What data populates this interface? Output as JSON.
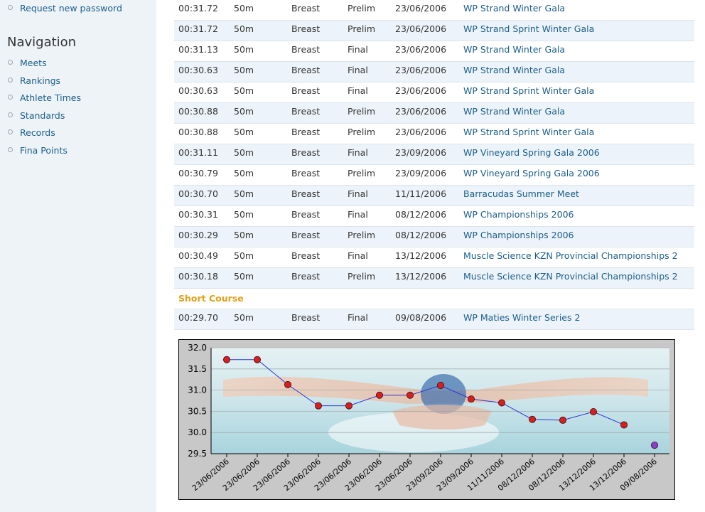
{
  "sidebar": {
    "top_link": "Request new password",
    "nav_title": "Navigation",
    "nav_items": [
      "Meets",
      "Rankings",
      "Athlete Times",
      "Standards",
      "Records",
      "Fina Points"
    ]
  },
  "results": {
    "long_course_rows": [
      {
        "time": "00:31.72",
        "distance": "50m",
        "stroke": "Breast",
        "round": "Prelim",
        "date": "23/06/2006",
        "meet": "WP Strand Winter Gala"
      },
      {
        "time": "00:31.72",
        "distance": "50m",
        "stroke": "Breast",
        "round": "Prelim",
        "date": "23/06/2006",
        "meet": "WP Strand Sprint Winter Gala"
      },
      {
        "time": "00:31.13",
        "distance": "50m",
        "stroke": "Breast",
        "round": "Final",
        "date": "23/06/2006",
        "meet": "WP Strand Winter Gala"
      },
      {
        "time": "00:30.63",
        "distance": "50m",
        "stroke": "Breast",
        "round": "Final",
        "date": "23/06/2006",
        "meet": "WP Strand Winter Gala"
      },
      {
        "time": "00:30.63",
        "distance": "50m",
        "stroke": "Breast",
        "round": "Final",
        "date": "23/06/2006",
        "meet": "WP Strand Sprint Winter Gala"
      },
      {
        "time": "00:30.88",
        "distance": "50m",
        "stroke": "Breast",
        "round": "Prelim",
        "date": "23/06/2006",
        "meet": "WP Strand Winter Gala"
      },
      {
        "time": "00:30.88",
        "distance": "50m",
        "stroke": "Breast",
        "round": "Prelim",
        "date": "23/06/2006",
        "meet": "WP Strand Sprint Winter Gala"
      },
      {
        "time": "00:31.11",
        "distance": "50m",
        "stroke": "Breast",
        "round": "Final",
        "date": "23/09/2006",
        "meet": "WP Vineyard Spring Gala 2006"
      },
      {
        "time": "00:30.79",
        "distance": "50m",
        "stroke": "Breast",
        "round": "Prelim",
        "date": "23/09/2006",
        "meet": "WP Vineyard Spring Gala 2006"
      },
      {
        "time": "00:30.70",
        "distance": "50m",
        "stroke": "Breast",
        "round": "Final",
        "date": "11/11/2006",
        "meet": "Barracudas Summer Meet"
      },
      {
        "time": "00:30.31",
        "distance": "50m",
        "stroke": "Breast",
        "round": "Final",
        "date": "08/12/2006",
        "meet": "WP Championships 2006"
      },
      {
        "time": "00:30.29",
        "distance": "50m",
        "stroke": "Breast",
        "round": "Prelim",
        "date": "08/12/2006",
        "meet": "WP Championships 2006"
      },
      {
        "time": "00:30.49",
        "distance": "50m",
        "stroke": "Breast",
        "round": "Final",
        "date": "13/12/2006",
        "meet": "Muscle Science KZN Provincial Championships 2"
      },
      {
        "time": "00:30.18",
        "distance": "50m",
        "stroke": "Breast",
        "round": "Prelim",
        "date": "13/12/2006",
        "meet": "Muscle Science KZN Provincial Championships 2"
      }
    ],
    "short_course_label": "Short Course",
    "short_course_rows": [
      {
        "time": "00:29.70",
        "distance": "50m",
        "stroke": "Breast",
        "round": "Final",
        "date": "09/08/2006",
        "meet": "WP Maties Winter Series 2"
      }
    ]
  },
  "colors": {
    "link": "#1b5e8a",
    "section_heading": "#e1a11a",
    "row_alt": "#edf3fa",
    "point_long_course": "#d62020",
    "point_short_course": "#8a3fd0",
    "line": "#2b35d6"
  },
  "chart_data": {
    "type": "line",
    "title": "",
    "xlabel": "",
    "ylabel": "",
    "ylim": [
      29.5,
      32.0
    ],
    "yticks": [
      "32.0",
      "31.5",
      "31.0",
      "30.5",
      "30.0",
      "29.5"
    ],
    "grid": true,
    "categories": [
      "23/06/2006",
      "23/06/2006",
      "23/06/2006",
      "23/06/2006",
      "23/06/2006",
      "23/06/2006",
      "23/06/2006",
      "23/09/2006",
      "23/09/2006",
      "11/11/2006",
      "08/12/2006",
      "08/12/2006",
      "13/12/2006",
      "13/12/2006",
      "09/08/2006"
    ],
    "series": [
      {
        "values": [
          31.72,
          31.72,
          31.13,
          30.63,
          30.63,
          30.88,
          30.88,
          31.11,
          30.79,
          30.7,
          30.31,
          30.29,
          30.49,
          30.18,
          null
        ]
      },
      {
        "values": [
          null,
          null,
          null,
          null,
          null,
          null,
          null,
          null,
          null,
          null,
          null,
          null,
          null,
          null,
          29.7
        ]
      }
    ],
    "background_image": "butterfly-swimmer-photo"
  }
}
